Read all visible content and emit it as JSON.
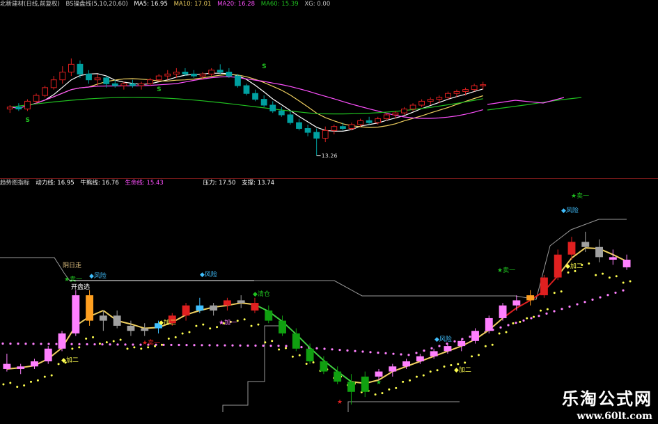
{
  "top_header": {
    "title": "北新建材(日线,前复权)",
    "indicator": "BS操盘线(5,10,20,60)",
    "ma5": "MA5: 16.95",
    "ma10": "MA10: 17.01",
    "ma20": "MA20: 16.28",
    "ma60": "MA60: 15.39",
    "xg": "XG: 0.00"
  },
  "bottom_header": {
    "title": "趋势图指标",
    "dongli": "动力线: 16.95",
    "niuxiong": "牛熊线: 16.76",
    "shengming": "生命线: 15.43",
    "yali": "压力: 17.50",
    "zhicheng": "支撑: 13.74"
  },
  "colors": {
    "up": "#e02020",
    "down": "#00a0a0",
    "ma5": "#ffffff",
    "ma10": "#f0d060",
    "ma20": "#ff50ff",
    "ma60": "#20c020",
    "pink": "#ff80ff",
    "gray": "#a0a0a0",
    "green": "#10a010",
    "orange": "#ffa020",
    "cyan": "#40c0ff",
    "yellow": "#ffff50"
  },
  "chart_data": {
    "type": "candlestick",
    "top_panel": {
      "candles": [
        [
          15.7,
          15.9,
          15.5,
          15.8
        ],
        [
          15.8,
          16.0,
          15.6,
          15.7
        ],
        [
          15.7,
          16.2,
          15.6,
          16.1
        ],
        [
          16.1,
          16.5,
          16.0,
          16.4
        ],
        [
          16.4,
          16.9,
          16.3,
          16.8
        ],
        [
          16.8,
          17.4,
          16.7,
          17.2
        ],
        [
          17.2,
          17.9,
          17.0,
          17.6
        ],
        [
          17.6,
          18.3,
          17.4,
          18.0
        ],
        [
          18.0,
          18.2,
          17.3,
          17.5
        ],
        [
          17.5,
          17.7,
          17.0,
          17.2
        ],
        [
          17.2,
          17.5,
          16.9,
          17.3
        ],
        [
          17.3,
          17.4,
          16.8,
          17.0
        ],
        [
          17.0,
          17.2,
          16.8,
          16.9
        ],
        [
          16.9,
          17.1,
          16.7,
          17.0
        ],
        [
          17.0,
          17.2,
          16.8,
          16.9
        ],
        [
          16.9,
          17.1,
          16.7,
          17.0
        ],
        [
          17.0,
          17.3,
          16.9,
          17.2
        ],
        [
          17.2,
          17.5,
          17.1,
          17.4
        ],
        [
          17.4,
          17.7,
          17.2,
          17.5
        ],
        [
          17.5,
          17.8,
          17.3,
          17.6
        ],
        [
          17.6,
          17.8,
          17.4,
          17.5
        ],
        [
          17.5,
          17.7,
          17.3,
          17.4
        ],
        [
          17.4,
          17.6,
          17.2,
          17.5
        ],
        [
          17.5,
          17.8,
          17.4,
          17.7
        ],
        [
          17.7,
          18.0,
          17.5,
          17.6
        ],
        [
          17.6,
          17.8,
          17.3,
          17.4
        ],
        [
          17.4,
          17.5,
          16.8,
          16.9
        ],
        [
          16.9,
          17.0,
          16.4,
          16.5
        ],
        [
          16.5,
          16.7,
          16.1,
          16.2
        ],
        [
          16.2,
          16.4,
          15.8,
          15.9
        ],
        [
          15.9,
          16.1,
          15.5,
          15.6
        ],
        [
          15.6,
          15.8,
          15.3,
          15.4
        ],
        [
          15.4,
          15.6,
          14.9,
          15.0
        ],
        [
          15.0,
          15.2,
          14.6,
          14.7
        ],
        [
          14.7,
          14.9,
          14.3,
          14.5
        ],
        [
          14.5,
          14.7,
          13.3,
          14.2
        ],
        [
          14.2,
          14.8,
          14.0,
          14.6
        ],
        [
          14.6,
          14.9,
          14.4,
          14.8
        ],
        [
          14.8,
          15.0,
          14.6,
          14.7
        ],
        [
          14.7,
          15.0,
          14.6,
          14.9
        ],
        [
          14.9,
          15.2,
          14.8,
          15.1
        ],
        [
          15.1,
          15.3,
          14.9,
          15.0
        ],
        [
          15.0,
          15.3,
          14.9,
          15.2
        ],
        [
          15.2,
          15.5,
          15.1,
          15.4
        ],
        [
          15.4,
          15.6,
          15.2,
          15.5
        ],
        [
          15.5,
          15.8,
          15.4,
          15.7
        ],
        [
          15.7,
          16.0,
          15.6,
          15.9
        ],
        [
          15.9,
          16.2,
          15.8,
          16.1
        ],
        [
          16.1,
          16.3,
          15.9,
          16.2
        ],
        [
          16.2,
          16.4,
          16.0,
          16.3
        ],
        [
          16.3,
          16.6,
          16.2,
          16.5
        ],
        [
          16.5,
          16.7,
          16.3,
          16.6
        ],
        [
          16.6,
          16.8,
          16.4,
          16.7
        ],
        [
          16.7,
          17.0,
          16.6,
          16.9
        ],
        [
          16.9,
          17.1,
          16.7,
          16.95
        ]
      ],
      "ylim": [
        13.0,
        18.8
      ],
      "low_label": "13.26",
      "s_markers": [
        "S",
        "S",
        "S"
      ]
    },
    "bottom_panel": {
      "candles": [
        [
          14.9,
          15.3,
          14.6,
          14.7
        ],
        [
          14.7,
          14.9,
          14.5,
          14.8
        ],
        [
          14.8,
          15.1,
          14.7,
          15.0
        ],
        [
          15.0,
          15.6,
          14.9,
          15.5
        ],
        [
          15.5,
          16.2,
          15.4,
          16.1
        ],
        [
          16.1,
          17.8,
          16.0,
          17.6
        ],
        [
          17.6,
          17.8,
          16.4,
          16.6
        ],
        [
          16.6,
          17.0,
          16.2,
          16.8
        ],
        [
          16.8,
          17.0,
          16.3,
          16.4
        ],
        [
          16.4,
          16.6,
          16.0,
          16.2
        ],
        [
          16.2,
          16.5,
          16.0,
          16.3
        ],
        [
          16.3,
          16.6,
          16.1,
          16.5
        ],
        [
          16.5,
          16.9,
          16.4,
          16.8
        ],
        [
          16.8,
          17.3,
          16.6,
          17.2
        ],
        [
          17.2,
          17.5,
          16.9,
          17.0
        ],
        [
          17.0,
          17.3,
          16.8,
          17.2
        ],
        [
          17.2,
          17.5,
          17.0,
          17.4
        ],
        [
          17.4,
          17.6,
          17.1,
          17.3
        ],
        [
          17.3,
          17.5,
          16.9,
          17.0
        ],
        [
          17.0,
          17.2,
          16.5,
          16.6
        ],
        [
          16.6,
          16.8,
          16.0,
          16.1
        ],
        [
          16.1,
          16.3,
          15.4,
          15.5
        ],
        [
          15.5,
          15.7,
          14.9,
          15.0
        ],
        [
          15.0,
          15.2,
          14.5,
          14.6
        ],
        [
          14.6,
          14.8,
          14.1,
          14.2
        ],
        [
          14.2,
          14.5,
          13.3,
          13.8
        ],
        [
          13.8,
          14.6,
          13.6,
          14.4
        ],
        [
          14.4,
          14.7,
          14.2,
          14.6
        ],
        [
          14.6,
          14.9,
          14.4,
          14.8
        ],
        [
          14.8,
          15.1,
          14.7,
          15.0
        ],
        [
          15.0,
          15.3,
          14.9,
          15.2
        ],
        [
          15.2,
          15.5,
          15.1,
          15.4
        ],
        [
          15.4,
          15.7,
          15.3,
          15.6
        ],
        [
          15.6,
          15.9,
          15.4,
          15.8
        ],
        [
          15.8,
          16.3,
          15.7,
          16.2
        ],
        [
          16.2,
          16.8,
          16.1,
          16.7
        ],
        [
          16.7,
          17.3,
          16.6,
          17.2
        ],
        [
          17.2,
          17.6,
          17.0,
          17.4
        ],
        [
          17.4,
          17.8,
          17.2,
          17.6
        ],
        [
          17.6,
          18.4,
          17.5,
          18.3
        ],
        [
          18.3,
          19.4,
          18.2,
          19.2
        ],
        [
          19.2,
          19.9,
          19.0,
          19.7
        ],
        [
          19.7,
          20.1,
          19.3,
          19.5
        ],
        [
          19.5,
          19.8,
          18.9,
          19.1
        ],
        [
          19.1,
          19.4,
          18.8,
          19.0
        ],
        [
          19.0,
          19.2,
          18.6,
          18.7
        ]
      ],
      "ylim": [
        13.0,
        21.0
      ],
      "resistance": "压力: 17.50",
      "support": "支撑: 13.74"
    },
    "annotations": [
      {
        "text": "阴日走",
        "kind": "label"
      },
      {
        "text": "开盘选",
        "kind": "label"
      },
      {
        "text": "◆风险",
        "kind": "cyan"
      },
      {
        "text": "◆风险",
        "kind": "cyan"
      },
      {
        "text": "★卖一",
        "kind": "green"
      },
      {
        "text": "◆加二",
        "kind": "yellow"
      },
      {
        "text": "◆加二",
        "kind": "yellow"
      },
      {
        "text": "★卖一",
        "kind": "red"
      },
      {
        "text": "★加一",
        "kind": "pink"
      },
      {
        "text": "◆清仓",
        "kind": "green"
      },
      {
        "text": "◆风险",
        "kind": "cyan"
      },
      {
        "text": "◆加二",
        "kind": "yellow"
      },
      {
        "text": "★卖一",
        "kind": "green"
      },
      {
        "text": "◆加二",
        "kind": "yellow"
      },
      {
        "text": "★卖一",
        "kind": "green"
      },
      {
        "text": "◆风险",
        "kind": "cyan"
      },
      {
        "text": "★",
        "kind": "red"
      },
      {
        "text": "★",
        "kind": "green"
      }
    ]
  },
  "watermark": {
    "cn": "乐淘公式网",
    "url": "www.60lt.com"
  }
}
